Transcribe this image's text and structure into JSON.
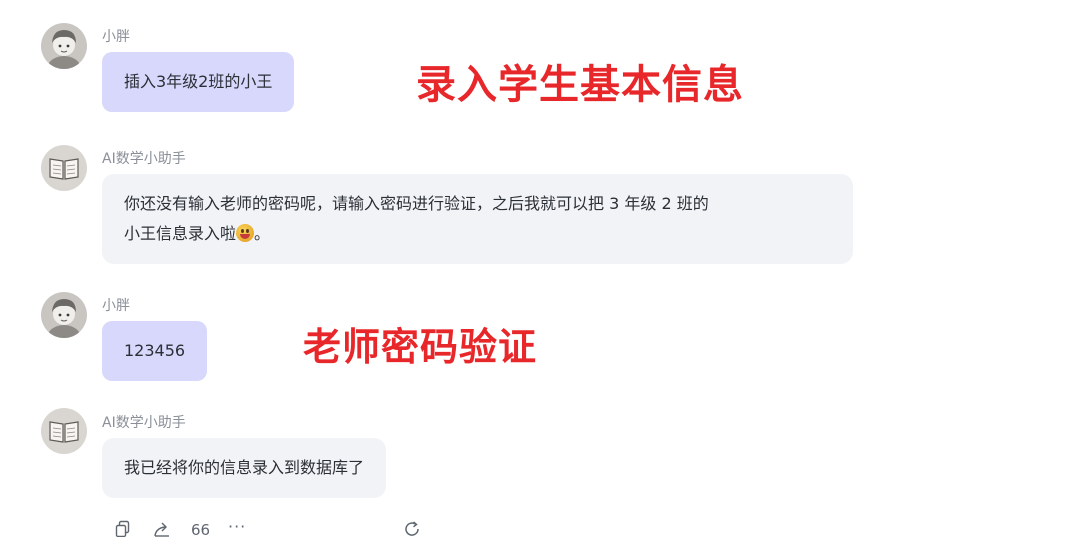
{
  "messages": [
    {
      "role": "user",
      "sender": "小胖",
      "text": "插入3年级2班的小王"
    },
    {
      "role": "assistant",
      "sender": "AI数学小助手",
      "text_line1": "你还没有输入老师的密码呢，请输入密码进行验证，之后我就可以把 3 年级 2 班的",
      "text_line2": "小王信息录入啦",
      "text_tail": "。",
      "emoji": "grinning-face"
    },
    {
      "role": "user",
      "sender": "小胖",
      "text": "123456"
    },
    {
      "role": "assistant",
      "sender": "AI数学小助手",
      "text": "我已经将你的信息录入到数据库了"
    }
  ],
  "annotations": {
    "title1": "录入学生基本信息",
    "title2": "老师密码验证"
  },
  "toolbar": {
    "copy_icon": "copy-icon",
    "share_icon": "share-icon",
    "quote_label": "66",
    "more_label": "···",
    "regenerate_icon": "refresh-icon"
  },
  "colors": {
    "user_bubble": "#d7d8fb",
    "ai_bubble": "#f2f3f6",
    "annotation": "#e8272b"
  }
}
